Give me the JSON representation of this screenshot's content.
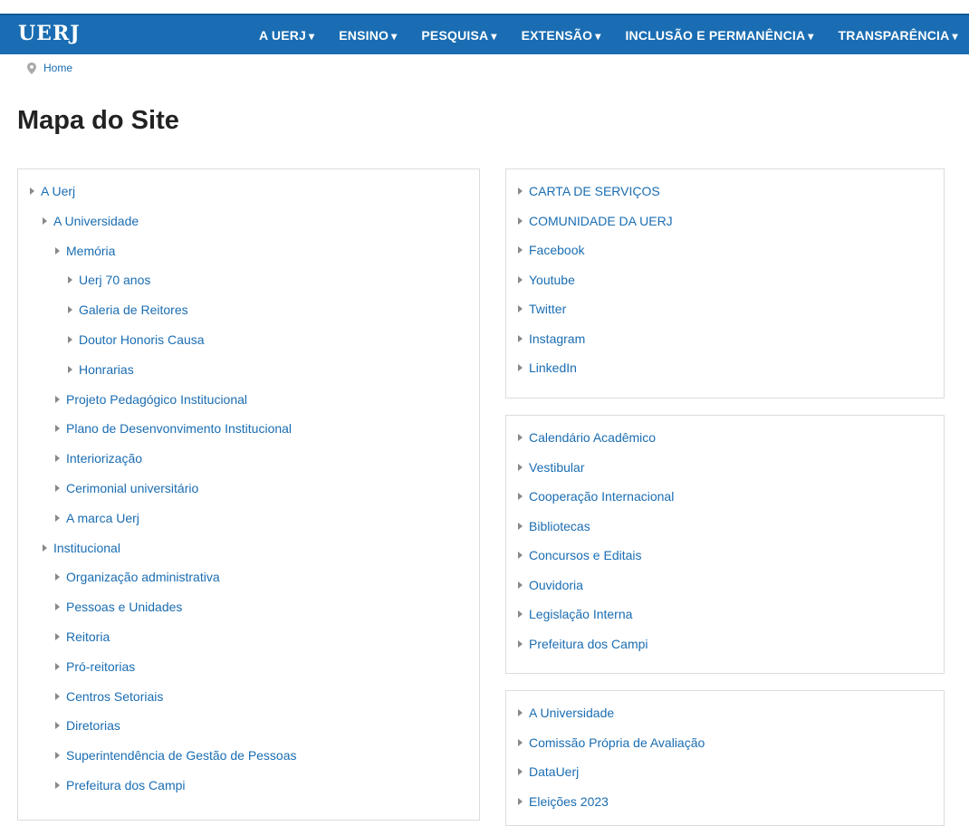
{
  "header": {
    "brand": "UERJ",
    "nav": [
      {
        "label": "A UERJ",
        "caret": "▾"
      },
      {
        "label": "ENSINO",
        "caret": "▾"
      },
      {
        "label": "PESQUISA",
        "caret": "▾"
      },
      {
        "label": "EXTENSÃO",
        "caret": "▾"
      },
      {
        "label": "INCLUSÃO E PERMANÊNCIA",
        "caret": "▾"
      },
      {
        "label": "TRANSPARÊNCIA",
        "caret": "▾"
      }
    ]
  },
  "breadcrumb": {
    "home": "Home"
  },
  "page": {
    "title": "Mapa do Site"
  },
  "left_tree": [
    {
      "label": "A Uerj",
      "level": 0
    },
    {
      "label": "A Universidade",
      "level": 1
    },
    {
      "label": "Memória",
      "level": 2
    },
    {
      "label": "Uerj 70 anos",
      "level": 3
    },
    {
      "label": "Galeria de Reitores",
      "level": 3
    },
    {
      "label": "Doutor Honoris Causa",
      "level": 3
    },
    {
      "label": "Honrarias",
      "level": 3
    },
    {
      "label": "Projeto Pedagógico Institucional",
      "level": 2
    },
    {
      "label": "Plano de Desenvonvimento Institucional",
      "level": 2
    },
    {
      "label": "Interiorização",
      "level": 2
    },
    {
      "label": "Cerimonial universitário",
      "level": 2
    },
    {
      "label": "A marca Uerj",
      "level": 2
    },
    {
      "label": "Institucional",
      "level": 1
    },
    {
      "label": "Organização administrativa",
      "level": 2
    },
    {
      "label": "Pessoas e Unidades",
      "level": 2
    },
    {
      "label": "Reitoria",
      "level": 2
    },
    {
      "label": "Pró-reitorias",
      "level": 2
    },
    {
      "label": "Centros Setoriais",
      "level": 2
    },
    {
      "label": "Diretorias",
      "level": 2
    },
    {
      "label": "Superintendência de Gestão de Pessoas",
      "level": 2
    },
    {
      "label": "Prefeitura dos Campi",
      "level": 2
    }
  ],
  "right_panels": [
    {
      "items": [
        "CARTA DE SERVIÇOS",
        "COMUNIDADE DA UERJ",
        "Facebook",
        "Youtube",
        "Twitter",
        "Instagram",
        "LinkedIn"
      ]
    },
    {
      "items": [
        "Calendário Acadêmico",
        "Vestibular",
        "Cooperação Internacional",
        "Bibliotecas",
        "Concursos e Editais",
        "Ouvidoria",
        "Legislação Interna",
        "Prefeitura dos Campi"
      ]
    },
    {
      "items": [
        "A Universidade",
        "Comissão Própria de Avaliação",
        "DataUerj",
        "Eleições 2023"
      ]
    }
  ],
  "colors": {
    "navbar": "#1a6db2",
    "link": "#1a6db2",
    "title": "#222222"
  }
}
